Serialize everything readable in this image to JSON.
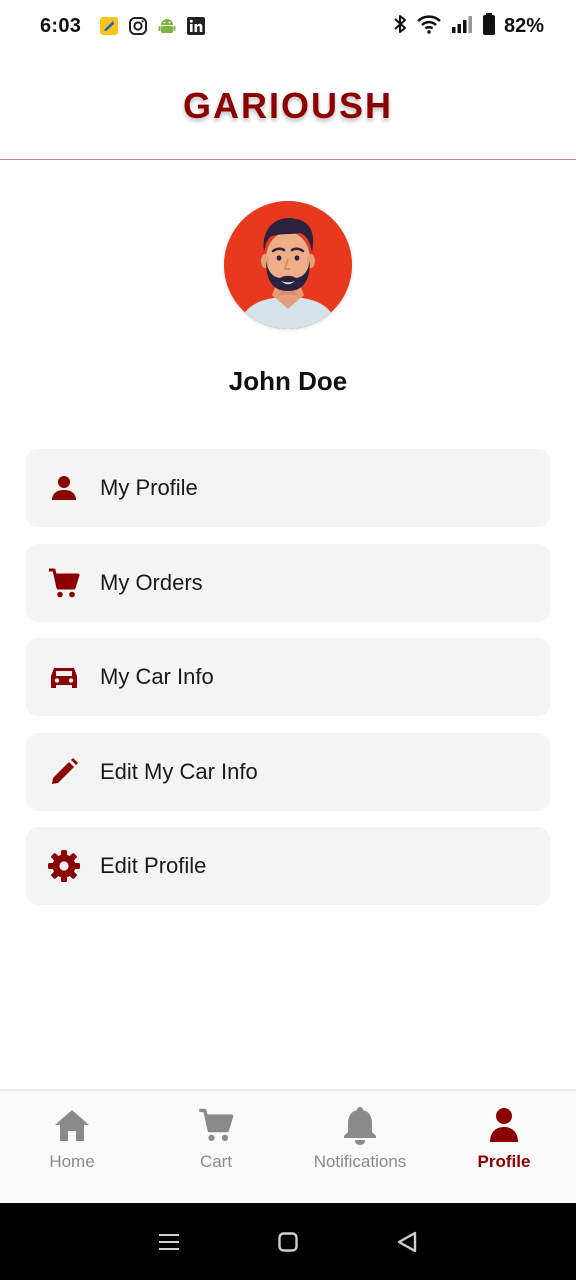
{
  "status_bar": {
    "time": "6:03",
    "battery_percent": "82%",
    "icons": [
      "app-icon",
      "instagram-icon",
      "android-icon",
      "linkedin-icon",
      "bluetooth-icon",
      "wifi-icon",
      "signal-icon",
      "battery-icon"
    ]
  },
  "header": {
    "brand": "GARIOUSH"
  },
  "profile": {
    "name": "John Doe",
    "avatar_icon": "avatar-illustration"
  },
  "menu": {
    "items": [
      {
        "label": "My Profile",
        "icon": "person-icon"
      },
      {
        "label": "My Orders",
        "icon": "cart-icon"
      },
      {
        "label": "My Car Info",
        "icon": "car-icon"
      },
      {
        "label": "Edit My Car Info",
        "icon": "pencil-icon"
      },
      {
        "label": "Edit Profile",
        "icon": "gear-icon"
      }
    ]
  },
  "bottom_nav": {
    "items": [
      {
        "label": "Home",
        "icon": "home-icon",
        "active": false
      },
      {
        "label": "Cart",
        "icon": "cart-icon",
        "active": false
      },
      {
        "label": "Notifications",
        "icon": "bell-icon",
        "active": false
      },
      {
        "label": "Profile",
        "icon": "person-icon",
        "active": true
      }
    ]
  },
  "system_nav": {
    "buttons": [
      "recents-icon",
      "home-square-icon",
      "back-triangle-icon"
    ]
  },
  "colors": {
    "accent": "#8b0000",
    "card_bg": "#f4f4f4",
    "inactive": "#8a8a8a",
    "avatar_bg": "#e8391f"
  }
}
